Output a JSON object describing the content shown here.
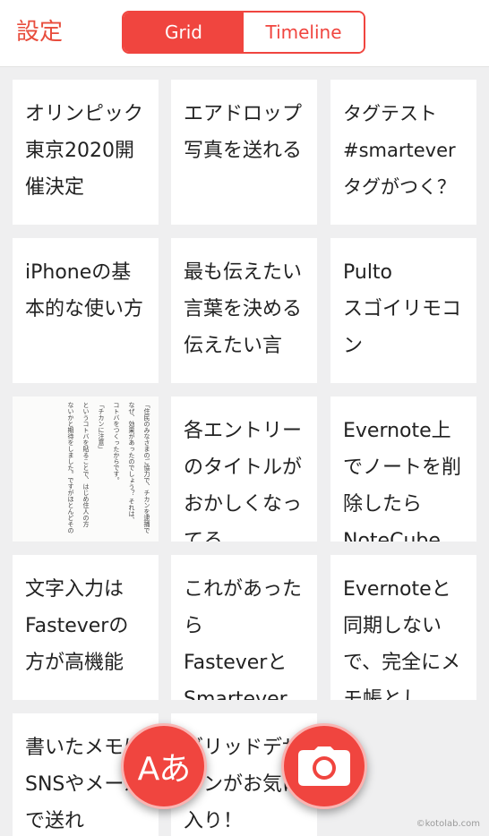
{
  "header": {
    "settings_label": "設定",
    "tabs": [
      {
        "label": "Grid",
        "active": true
      },
      {
        "label": "Timeline",
        "active": false
      }
    ]
  },
  "colors": {
    "accent": "#f0453f",
    "settings_text": "#e84d3d"
  },
  "notes": [
    {
      "title": "オリンピック東京2020開催決定"
    },
    {
      "title": "エアドロップ\n写真を送れる"
    },
    {
      "title": "タグテスト\n#smartever\nタグがつく？"
    },
    {
      "title": "iPhoneの基本的な使い方"
    },
    {
      "title": "最も伝えたい言葉を決める\n伝えたい言"
    },
    {
      "title": "Pulto\nスゴイリモコン"
    },
    {
      "title": "",
      "thumbnail": "document-image",
      "thumb_text": [
        "「住民のみなさまのご協力で、チカンを逮捕で",
        "なぜ、効果があったのでしょう？ それは、",
        "コトバをつくったからです。",
        "「チカンに注意」",
        "というコトバを貼ることで、はじめ住人の方",
        "ないかと期待をしました。ですがほとんどその"
      ]
    },
    {
      "title": "各エントリーのタイトルがおかしくなってる"
    },
    {
      "title": "Evernote上でノートを削除したらNoteCube"
    },
    {
      "title": "文字入力はFasteverの方が高機能"
    },
    {
      "title": "これがあったら\nFasteverとSmartever"
    },
    {
      "title": "Evernoteと同期しないで、完全にメモ帳とし"
    },
    {
      "title": "書いたメモはSNSやメールで送れ"
    },
    {
      "title": "グリッドデザインがお気に入り！"
    }
  ],
  "fab_text": {
    "label": "Aあ",
    "icon": "text-input-icon"
  },
  "fab_camera": {
    "icon": "camera-icon"
  },
  "watermark": "©kotolab.com"
}
